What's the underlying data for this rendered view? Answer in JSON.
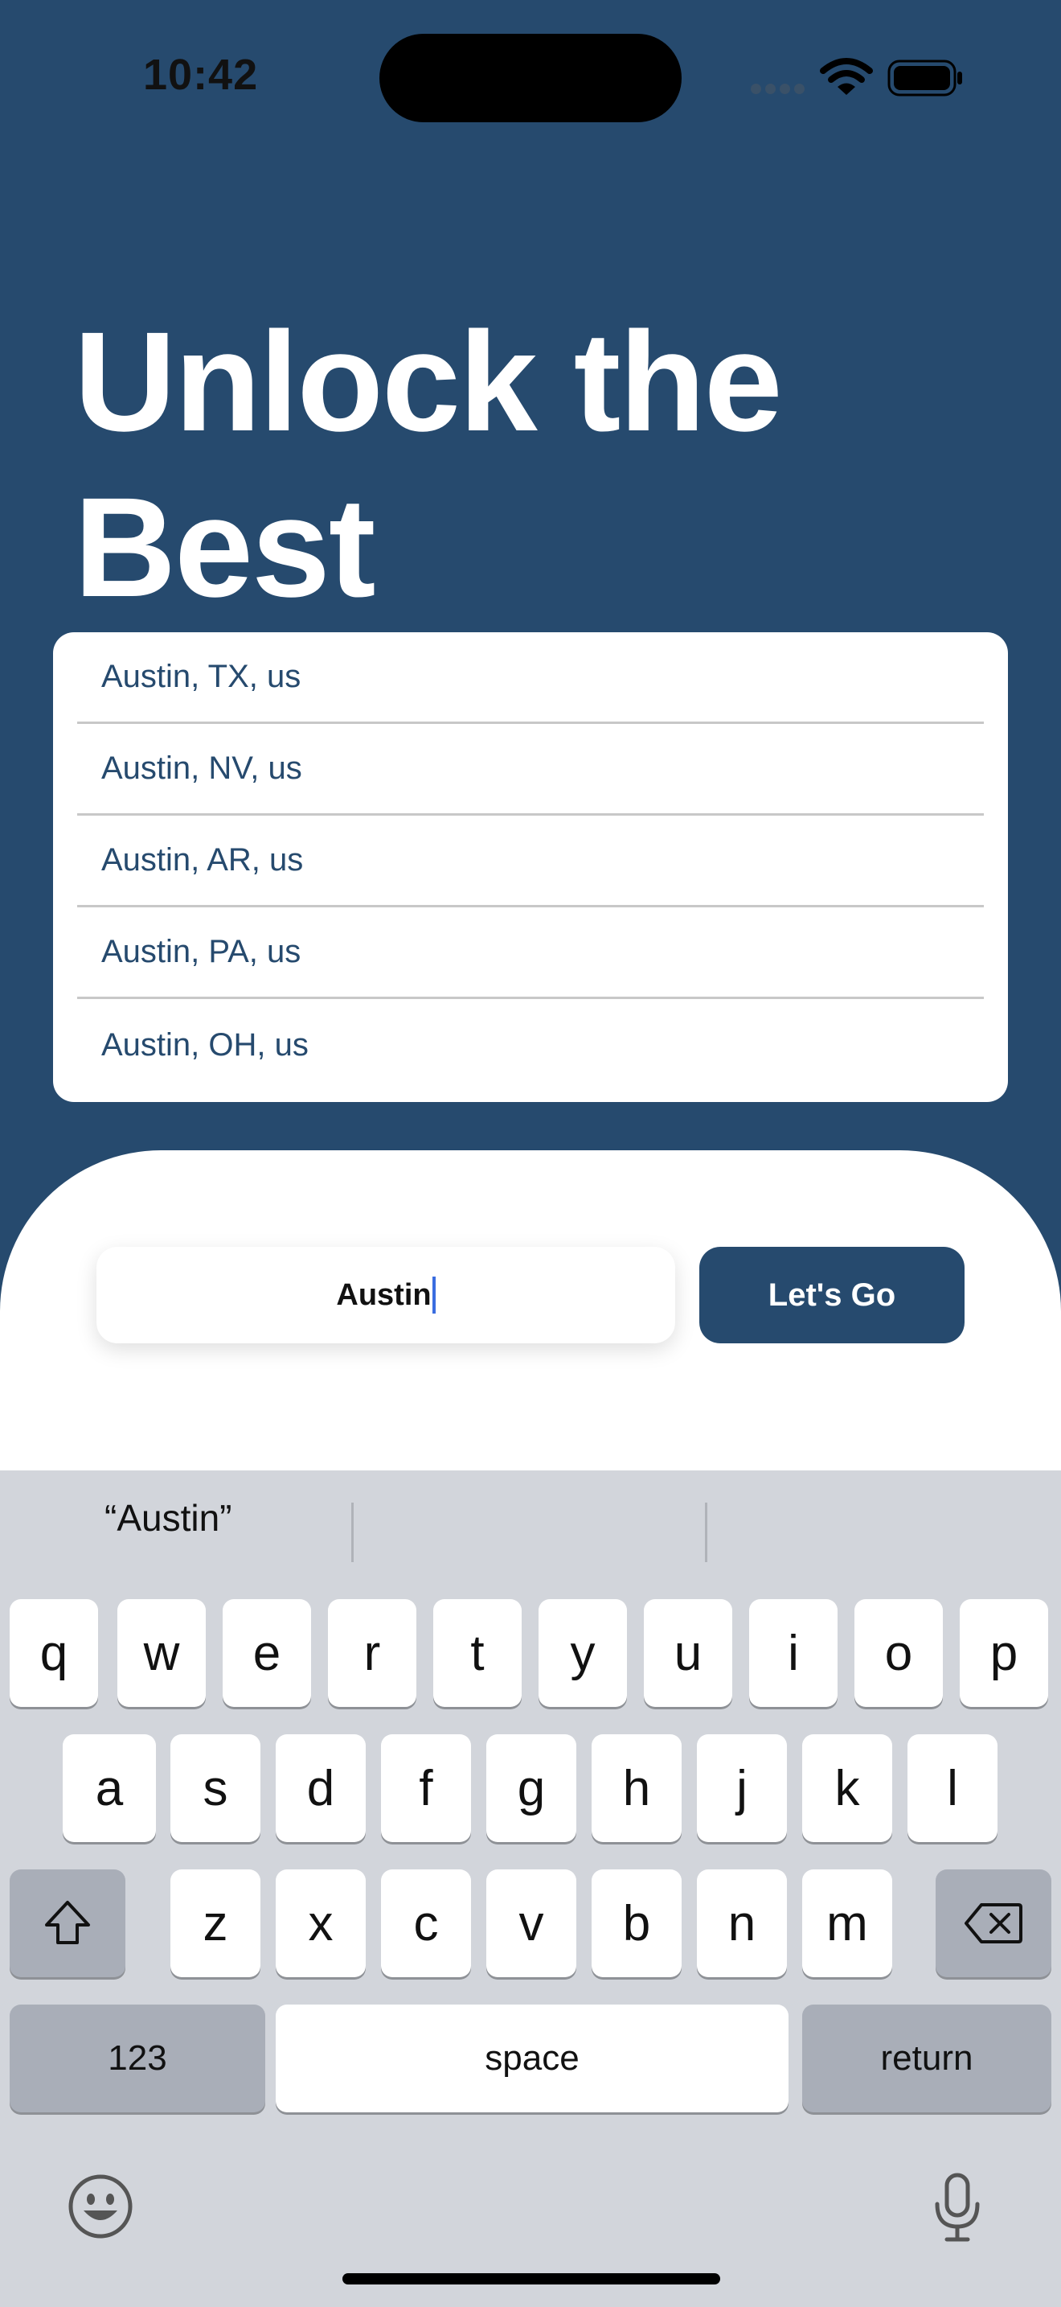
{
  "status": {
    "time": "10:42"
  },
  "hero": {
    "line1": "Unlock the",
    "line2": "Best"
  },
  "suggestions": [
    "Austin, TX, us",
    "Austin, NV, us",
    "Austin, AR, us",
    "Austin, PA, us",
    "Austin, OH, us"
  ],
  "search": {
    "value": "Austin"
  },
  "go_button": {
    "label": "Let's Go"
  },
  "keyboard": {
    "prediction": "“Austin”",
    "row1": [
      "q",
      "w",
      "e",
      "r",
      "t",
      "y",
      "u",
      "i",
      "o",
      "p"
    ],
    "row2": [
      "a",
      "s",
      "d",
      "f",
      "g",
      "h",
      "j",
      "k",
      "l"
    ],
    "row3": [
      "z",
      "x",
      "c",
      "v",
      "b",
      "n",
      "m"
    ],
    "numbers_label": "123",
    "space_label": "space",
    "return_label": "return"
  },
  "colors": {
    "brand": "#264A6E",
    "keyboard_bg": "#D2D5DB",
    "special_key": "#A9AEB8"
  }
}
